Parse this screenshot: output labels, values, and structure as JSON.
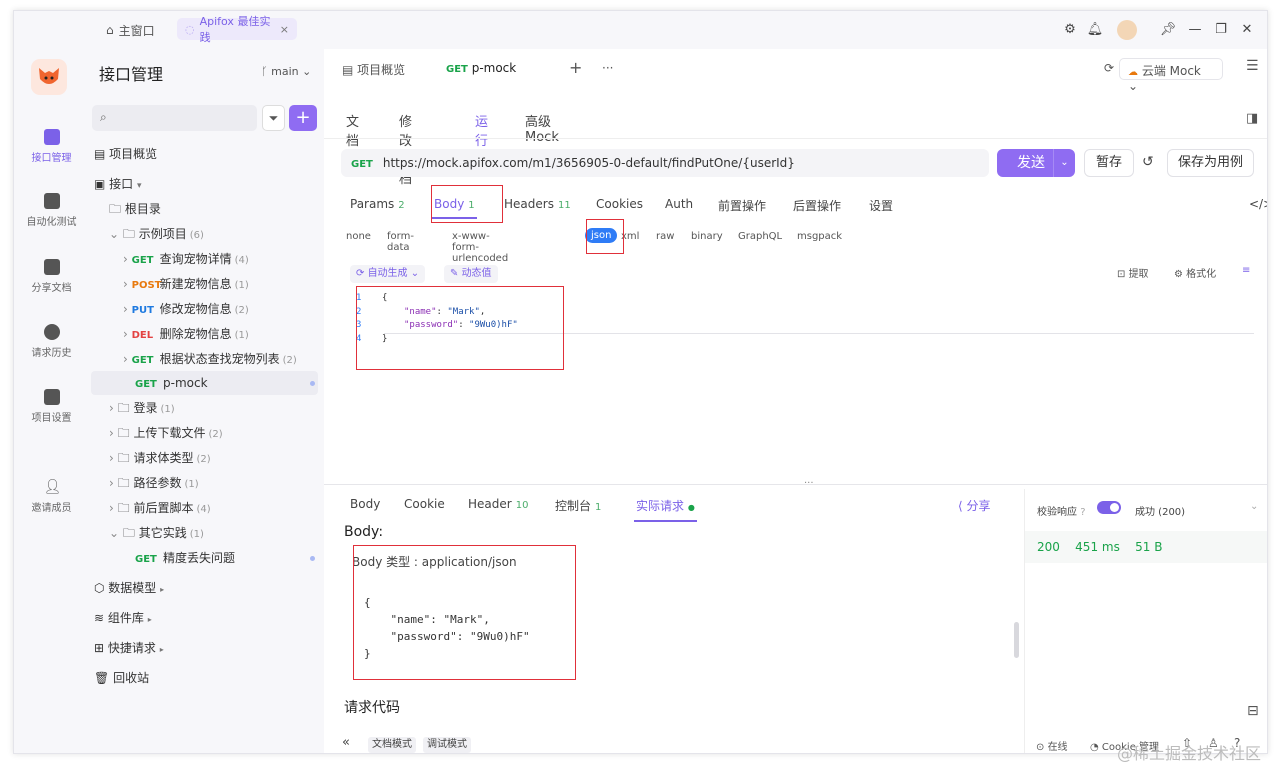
{
  "titlebar": {
    "home_tab": "主窗口",
    "active_tab": "Apifox 最佳实践",
    "tab_close": "×"
  },
  "rail": {
    "items": [
      {
        "label": "接口管理",
        "icon": "api-icon"
      },
      {
        "label": "自动化测试",
        "icon": "test-icon"
      },
      {
        "label": "分享文档",
        "icon": "share-doc-icon"
      },
      {
        "label": "请求历史",
        "icon": "history-icon"
      },
      {
        "label": "项目设置",
        "icon": "settings-icon"
      },
      {
        "label": "邀请成员",
        "icon": "invite-icon"
      }
    ]
  },
  "tree": {
    "title": "接口管理",
    "branch": "main",
    "add": "+",
    "overview": "项目概览",
    "api_root": "接口",
    "root_dir": "根目录",
    "example_folder": "示例项目",
    "example_count": "(6)",
    "endpoints": [
      {
        "method": "GET",
        "name": "查询宠物详情",
        "count": "(4)"
      },
      {
        "method": "POST",
        "name": "新建宠物信息",
        "count": "(1)"
      },
      {
        "method": "PUT",
        "name": "修改宠物信息",
        "count": "(2)"
      },
      {
        "method": "DEL",
        "name": "删除宠物信息",
        "count": "(1)"
      },
      {
        "method": "GET",
        "name": "根据状态查找宠物列表",
        "count": "(2)"
      }
    ],
    "selected": {
      "method": "GET",
      "name": "p-mock"
    },
    "folders": [
      {
        "name": "登录",
        "count": "(1)"
      },
      {
        "name": "上传下载文件",
        "count": "(2)"
      },
      {
        "name": "请求体类型",
        "count": "(2)"
      },
      {
        "name": "路径参数",
        "count": "(1)"
      },
      {
        "name": "前后置脚本",
        "count": "(4)"
      },
      {
        "name": "其它实践",
        "count": "(1)"
      }
    ],
    "other_child": {
      "method": "GET",
      "name": "精度丢失问题"
    },
    "data_model": "数据模型",
    "components": "组件库",
    "quick_request": "快捷请求",
    "recycle": "回收站"
  },
  "doc_tabs": {
    "overview": "项目概览",
    "current_method": "GET",
    "current_name": "p-mock",
    "plus": "+",
    "more": "···",
    "mock_label": "云端 Mock"
  },
  "sub_tabs": [
    "文档",
    "修改文档",
    "运行",
    "高级 Mock"
  ],
  "request": {
    "method": "GET",
    "url": "https://mock.apifox.com/m1/3656905-0-default/findPutOne/{userId}",
    "send": "发送",
    "save": "暂存",
    "save_as": "保存为用例"
  },
  "req_tabs": [
    {
      "label": "Params",
      "count": "2"
    },
    {
      "label": "Body",
      "count": "1"
    },
    {
      "label": "Headers",
      "count": "11"
    },
    {
      "label": "Cookies",
      "count": ""
    },
    {
      "label": "Auth",
      "count": ""
    },
    {
      "label": "前置操作",
      "count": ""
    },
    {
      "label": "后置操作",
      "count": ""
    },
    {
      "label": "设置",
      "count": ""
    }
  ],
  "body_types": [
    "none",
    "form-data",
    "x-www-form-urlencoded",
    "json",
    "xml",
    "raw",
    "binary",
    "GraphQL",
    "msgpack"
  ],
  "body_tools": {
    "auto_gen": "自动生成",
    "dynamic": "动态值",
    "extract": "提取",
    "format": "格式化"
  },
  "editor": {
    "lines": [
      "1",
      "2",
      "3",
      "4"
    ],
    "open": "{",
    "k1": "\"name\"",
    "v1": "\"Mark\"",
    "k2": "\"password\"",
    "v2": "\"9Wu0)hF\"",
    "close": "}"
  },
  "resp_tabs": [
    {
      "label": "Body",
      "count": ""
    },
    {
      "label": "Cookie",
      "count": ""
    },
    {
      "label": "Header",
      "count": "10"
    },
    {
      "label": "控制台",
      "count": "1"
    },
    {
      "label": "实际请求",
      "count": ""
    }
  ],
  "share": "分享",
  "validate": {
    "label": "校验响应",
    "result": "成功 (200)"
  },
  "status": {
    "code": "200",
    "time": "451 ms",
    "size": "51 B"
  },
  "resp_body": {
    "title": "Body:",
    "content_type": "Body 类型 : application/json",
    "json": "{\n    \"name\": \"Mark\",\n    \"password\": \"9Wu0)hF\"\n}"
  },
  "req_code": "请求代码",
  "statusbar": {
    "doc_mode": "文档模式",
    "debug_mode": "调试模式",
    "online": "在线",
    "cookie": "Cookie 管理"
  },
  "watermark": "@稀土掘金技术社区",
  "colors": {
    "accent": "#7b61e8",
    "get": "#1aa34a",
    "post": "#e8790e",
    "put": "#1f7ae0",
    "del": "#e34242",
    "highlight": "#e0303a"
  }
}
